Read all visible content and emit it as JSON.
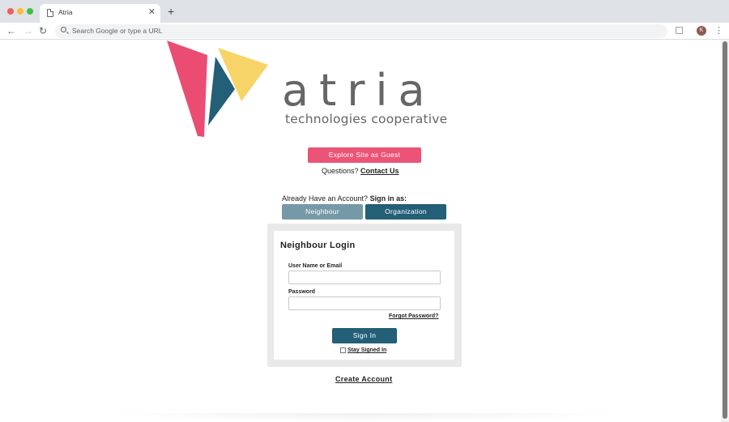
{
  "browser": {
    "tab_title": "Atria",
    "omnibox_placeholder": "Search Google or type a URL",
    "profile_initial": "K"
  },
  "logo": {
    "wordmark": "atria",
    "tagline": "technologies cooperative",
    "colors": {
      "pink": "#eb4d72",
      "yellow": "#f7d467",
      "teal": "#235f77"
    }
  },
  "hero": {
    "guest_button": "Explore Site as Guest",
    "questions_prefix": "Questions?",
    "contact_link": "Contact Us"
  },
  "signin_roles": {
    "prompt_prefix": "Already Have an Account?",
    "prompt_bold": "Sign in as:",
    "neighbour_button": "Neighbour",
    "organization_button": "Organization"
  },
  "login": {
    "title": "Neighbour Login",
    "username_label": "User Name or Email",
    "username_value": "",
    "password_label": "Password",
    "password_value": "",
    "forgot_link": "Forgot Password?",
    "signin_button": "Sign In",
    "stay_signed_in": "Stay Signed In",
    "stay_signed_in_checked": false
  },
  "footer": {
    "create_account": "Create Account"
  },
  "colors": {
    "accent_pink": "#eb5476",
    "neighbour_button": "#7599a7",
    "primary_teal": "#235f77"
  }
}
